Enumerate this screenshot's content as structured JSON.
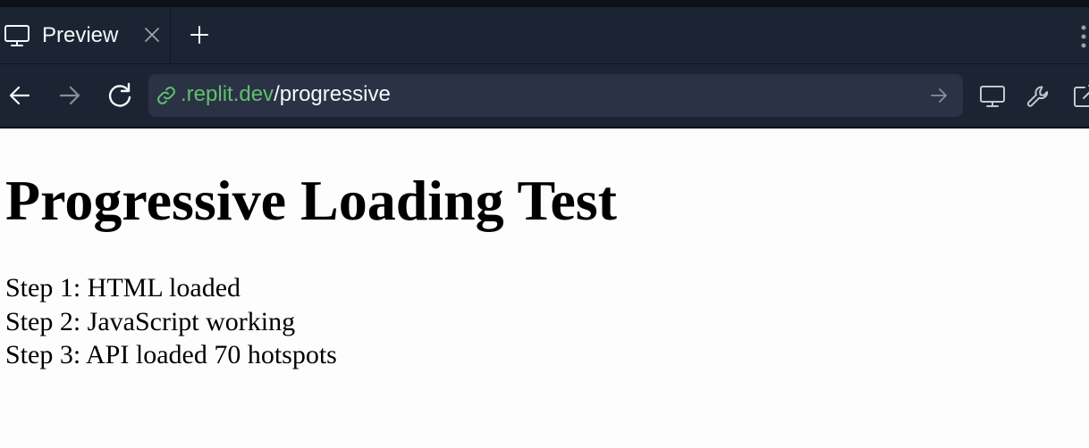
{
  "browser": {
    "tab": {
      "title": "Preview",
      "icon": "monitor-icon"
    },
    "url": {
      "domain": ".replit.dev",
      "path": "/progressive"
    },
    "colors": {
      "chrome": "#1c2333",
      "urlbar": "#2b3245",
      "domain": "#5dc26b"
    }
  },
  "page": {
    "heading": "Progressive Loading Test",
    "steps": [
      "Step 1: HTML loaded",
      "Step 2: JavaScript working",
      "Step 3: API loaded 70 hotspots"
    ]
  }
}
